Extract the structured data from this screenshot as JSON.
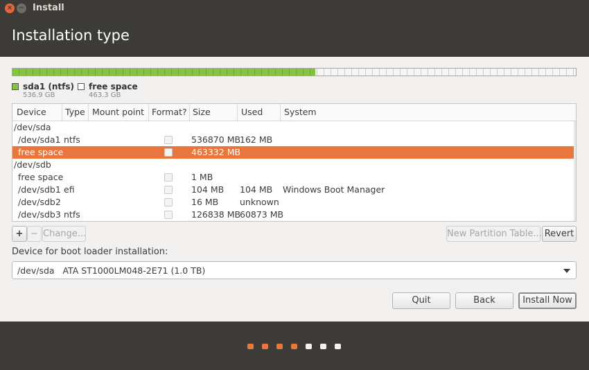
{
  "window": {
    "title": "Install"
  },
  "header": {
    "title": "Installation type"
  },
  "diskbar": {
    "used_fraction": 0.537
  },
  "legend": [
    {
      "label": "sda1 (ntfs)",
      "size": "536.9 GB",
      "color": "#83c340"
    },
    {
      "label": "free space",
      "size": "463.3 GB",
      "color": "#ffffff"
    }
  ],
  "table": {
    "columns": [
      "Device",
      "Type",
      "Mount point",
      "Format?",
      "Size",
      "Used",
      "System"
    ],
    "rows": [
      {
        "device": "/dev/sda",
        "type": "",
        "mount": "",
        "format": null,
        "size": "",
        "used": "",
        "system": "",
        "level": 0
      },
      {
        "device": "/dev/sda1",
        "type": "ntfs",
        "mount": "",
        "format": false,
        "size": "536870 MB",
        "used": "162 MB",
        "system": "",
        "level": 1
      },
      {
        "device": "free space",
        "type": "",
        "mount": "",
        "format": false,
        "size": "463332 MB",
        "used": "",
        "system": "",
        "level": 1,
        "selected": true
      },
      {
        "device": "/dev/sdb",
        "type": "",
        "mount": "",
        "format": null,
        "size": "",
        "used": "",
        "system": "",
        "level": 0
      },
      {
        "device": "free space",
        "type": "",
        "mount": "",
        "format": false,
        "size": "1 MB",
        "used": "",
        "system": "",
        "level": 1
      },
      {
        "device": "/dev/sdb1",
        "type": "efi",
        "mount": "",
        "format": false,
        "size": "104 MB",
        "used": "104 MB",
        "system": "Windows Boot Manager",
        "level": 1
      },
      {
        "device": "/dev/sdb2",
        "type": "",
        "mount": "",
        "format": false,
        "size": "16 MB",
        "used": "unknown",
        "system": "",
        "level": 1
      },
      {
        "device": "/dev/sdb3",
        "type": "ntfs",
        "mount": "",
        "format": false,
        "size": "126838 MB",
        "used": "60873 MB",
        "system": "",
        "level": 1
      }
    ]
  },
  "partition_buttons": {
    "add": "+",
    "remove": "−",
    "change": "Change..."
  },
  "new_table_button": "New Partition Table...",
  "revert_button": "Revert",
  "bootloader": {
    "label": "Device for boot loader installation:",
    "value": "/dev/sda   ATA ST1000LM048-2E71 (1.0 TB)"
  },
  "actions": {
    "quit": "Quit",
    "back": "Back",
    "install": "Install Now"
  },
  "progress": {
    "total": 7,
    "completed": 4,
    "active_color": "#e9763d",
    "inactive_color": "#f2f1f0"
  }
}
